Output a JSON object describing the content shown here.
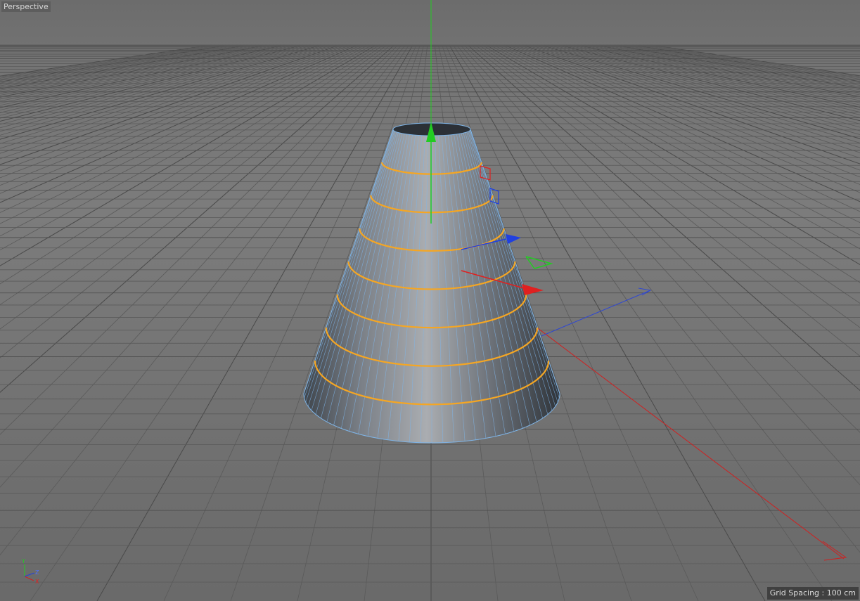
{
  "viewport": {
    "view_name": "Perspective",
    "grid_spacing": "Grid Spacing : 100 cm"
  },
  "object": {
    "type": "cone",
    "selected_edge_loops": 7,
    "colors": {
      "surface_light": "#a6a9ad",
      "surface_dark": "#3e444b",
      "wireframe": "#7fb4e6",
      "selected_loop": "#f5a623"
    }
  },
  "gizmo": {
    "colors": {
      "x": "#e02020",
      "y": "#22cc22",
      "z": "#2040e0"
    }
  },
  "axis_indicator": {
    "y_label": "Y",
    "z_label": "Z",
    "x_label": "X"
  },
  "colors": {
    "grid_line": "#5a5a5a",
    "grid_line_major": "#4a4a4a"
  }
}
